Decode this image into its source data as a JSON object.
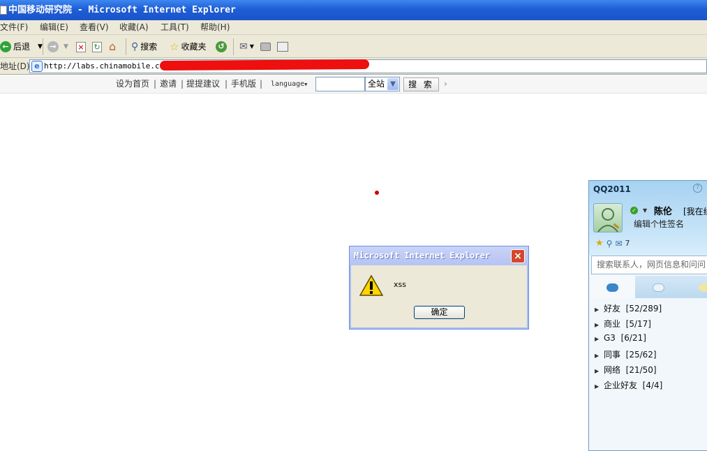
{
  "window": {
    "title": "中国移动研究院 - Microsoft Internet Explorer"
  },
  "menu": [
    "文件(F)",
    "编辑(E)",
    "查看(V)",
    "收藏(A)",
    "工具(T)",
    "帮助(H)"
  ],
  "toolbar": {
    "back": "后退",
    "search": "搜索",
    "favorites": "收藏夹"
  },
  "address": {
    "label": "地址(D)",
    "url": "http://labs.chinamobile.com/"
  },
  "site_nav": {
    "links": [
      "设为首页",
      "邀请",
      "提提建议",
      "手机版"
    ],
    "language": "language",
    "scope": "全站",
    "search_button": "搜 索"
  },
  "dialog": {
    "title": "Microsoft Internet Explorer",
    "message": "xss",
    "ok": "确定"
  },
  "qq": {
    "title": "QQ2011",
    "nickname": "陈伦",
    "status_text": "[我在线",
    "signature": "编辑个性签名",
    "mail_count": "7",
    "search_placeholder": "搜索联系人，网页信息和问问",
    "groups": [
      {
        "name": "好友",
        "count": "[52/289]"
      },
      {
        "name": "商业",
        "count": "[5/17]"
      },
      {
        "name": "G3",
        "count": "[6/21]"
      },
      {
        "name": "同事",
        "count": "[25/62]"
      },
      {
        "name": "网络",
        "count": "[21/50]"
      },
      {
        "name": "企业好友",
        "count": "[4/4]"
      }
    ]
  },
  "colors": {
    "titlebar": "#1f5ed6",
    "redaction": "#ee0f0f",
    "qq_panel": "#a7d2f2"
  }
}
